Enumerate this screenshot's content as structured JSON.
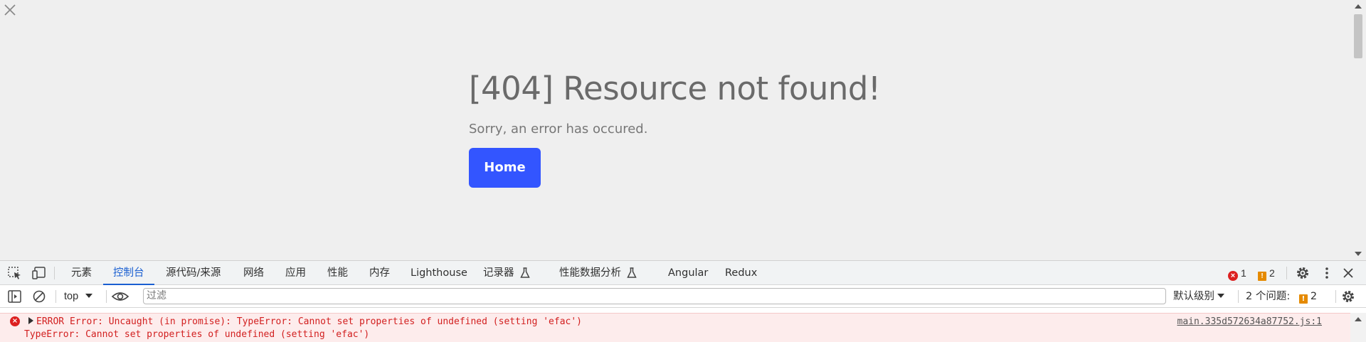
{
  "page": {
    "title": "[404] Resource not found!",
    "subtitle": "Sorry, an error has occured.",
    "home_button": "Home"
  },
  "devtools": {
    "tabs": [
      {
        "label": "元素"
      },
      {
        "label": "控制台"
      },
      {
        "label": "源代码/来源"
      },
      {
        "label": "网络"
      },
      {
        "label": "应用"
      },
      {
        "label": "性能"
      },
      {
        "label": "内存"
      },
      {
        "label": "Lighthouse"
      },
      {
        "label": "记录器"
      },
      {
        "label": "性能数据分析"
      },
      {
        "label": "Angular"
      },
      {
        "label": "Redux"
      }
    ],
    "active_tab": "控制台",
    "error_count": "1",
    "warning_count": "2",
    "console": {
      "context": "top",
      "filter_placeholder": "过滤",
      "level": "默认级别",
      "issues_label": "2 个问题:",
      "issues_count": "2"
    },
    "messages": [
      {
        "line1": "ERROR Error: Uncaught (in promise): TypeError: Cannot set properties of undefined (setting 'efac')",
        "line2": "TypeError: Cannot set properties of undefined (setting 'efac')",
        "source": "main.335d572634a87752.js:1"
      }
    ]
  },
  "colors": {
    "accent": "#3355ff",
    "devtools_active": "#1a5fd1",
    "error": "#d21f1f",
    "warning": "#e58a00"
  }
}
